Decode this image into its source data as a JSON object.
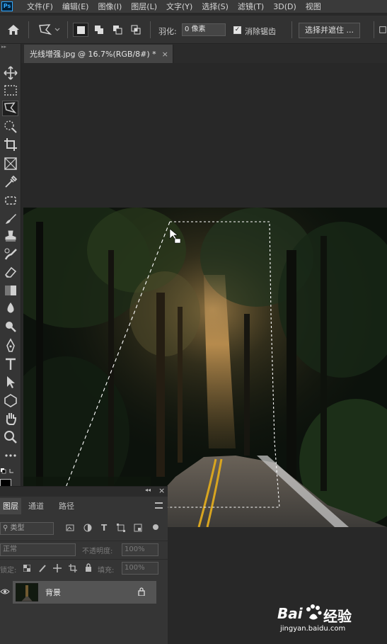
{
  "app": {
    "logo": "Ps"
  },
  "menu": [
    "文件(F)",
    "编辑(E)",
    "图像(I)",
    "图层(L)",
    "文字(Y)",
    "选择(S)",
    "滤镜(T)",
    "3D(D)",
    "视图"
  ],
  "options_bar": {
    "feather_label": "羽化:",
    "feather_value": "0 像素",
    "antialias_label": "消除锯齿",
    "antialias_checked": true,
    "select_mask_label": "选择并遮住 ..."
  },
  "document": {
    "tab_title": "光线增强.jpg @ 16.7%(RGB/8#) *",
    "close_glyph": "×"
  },
  "tools": [
    "move-icon",
    "marquee-icon",
    "polygonal-lasso-icon",
    "quick-select-icon",
    "crop-icon",
    "frame-icon",
    "eyedropper-icon",
    "healing-brush-icon",
    "brush-icon",
    "stamp-icon",
    "history-brush-icon",
    "eraser-icon",
    "gradient-icon",
    "blur-icon",
    "dodge-icon",
    "pen-icon",
    "type-icon",
    "path-select-icon",
    "shape-icon",
    "hand-icon",
    "zoom-icon",
    "more-icon"
  ],
  "layers_panel": {
    "collapse_glyph": "◂◂",
    "close_glyph": "×",
    "tabs": [
      "图层",
      "通道",
      "路径"
    ],
    "filter_kind": "类型",
    "blend_mode": "正常",
    "opacity_label": "不透明度:",
    "opacity_value": "100%",
    "lock_label": "锁定:",
    "fill_label": "填充:",
    "fill_value": "100%",
    "layers": [
      {
        "name": "背景",
        "visible": true,
        "locked": true
      }
    ]
  },
  "watermark": {
    "brand": "Bai",
    "brand2": "du",
    "site_cn": "经验",
    "url": "jingyan.baidu.com"
  },
  "colors": {
    "accent": "#31a8ff",
    "panel": "#353535",
    "canvas": "#282828"
  }
}
